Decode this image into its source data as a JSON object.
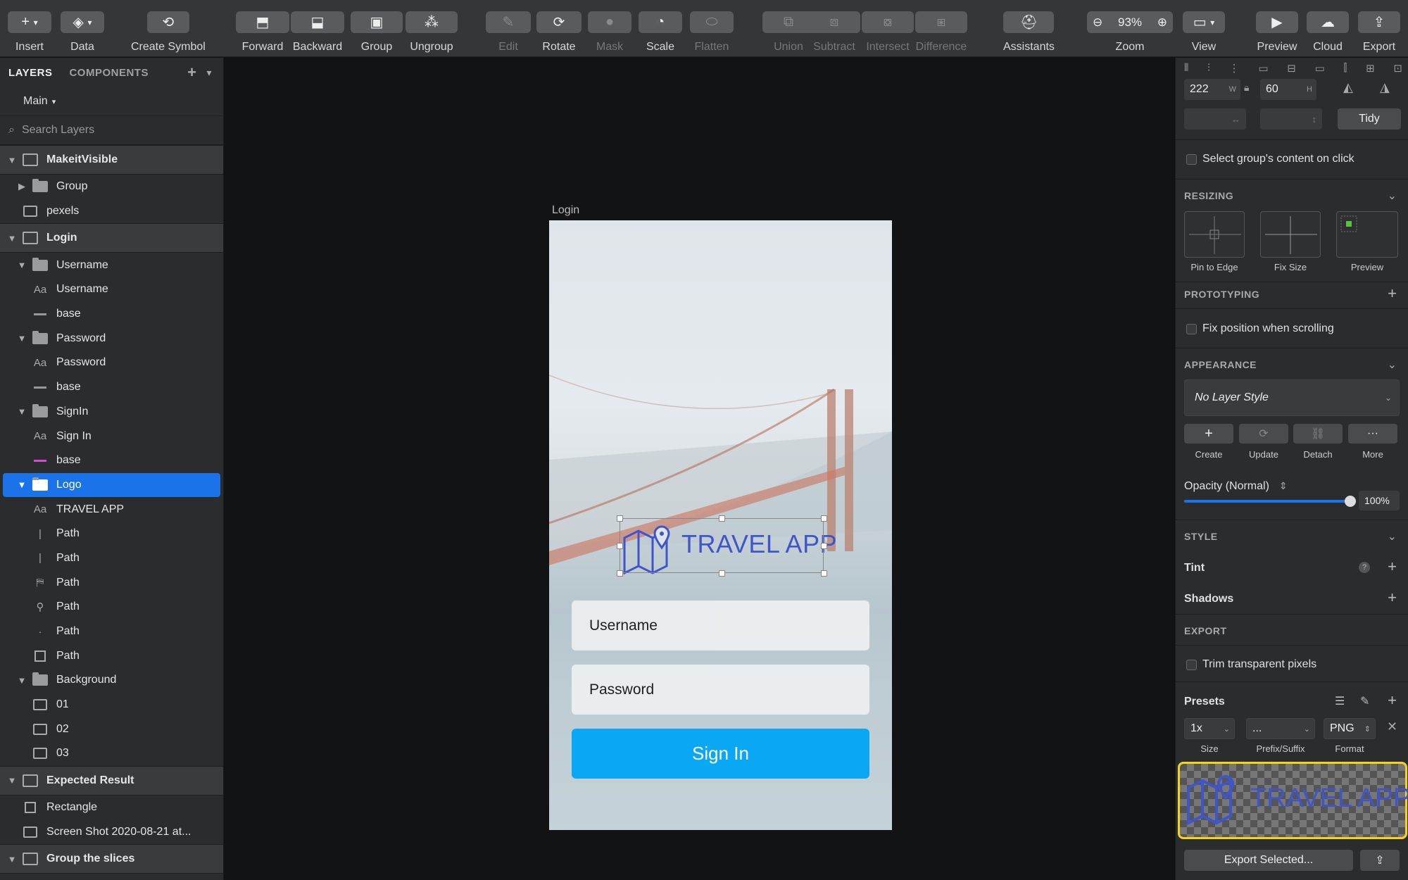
{
  "toolbar": {
    "insert": "Insert",
    "data": "Data",
    "create_symbol": "Create Symbol",
    "forward": "Forward",
    "backward": "Backward",
    "group": "Group",
    "ungroup": "Ungroup",
    "edit": "Edit",
    "rotate": "Rotate",
    "mask": "Mask",
    "scale": "Scale",
    "flatten": "Flatten",
    "union": "Union",
    "subtract": "Subtract",
    "intersect": "Intersect",
    "difference": "Difference",
    "assistants": "Assistants",
    "zoom_label": "Zoom",
    "zoom_value": "93%",
    "view": "View",
    "preview": "Preview",
    "cloud": "Cloud",
    "export": "Export"
  },
  "sidebar": {
    "tab_layers": "LAYERS",
    "tab_components": "COMPONENTS",
    "page": "Main",
    "search_placeholder": "Search Layers",
    "layers": [
      {
        "label": "MakeitVisible",
        "kind": "artboard"
      },
      {
        "label": "Group",
        "kind": "folder"
      },
      {
        "label": "pexels",
        "kind": "image"
      },
      {
        "label": "Login",
        "kind": "artboard"
      },
      {
        "label": "Username",
        "kind": "folder"
      },
      {
        "label": "Username",
        "kind": "text"
      },
      {
        "label": "base",
        "kind": "shape"
      },
      {
        "label": "Password",
        "kind": "folder"
      },
      {
        "label": "Password",
        "kind": "text"
      },
      {
        "label": "base",
        "kind": "shape"
      },
      {
        "label": "SignIn",
        "kind": "folder"
      },
      {
        "label": "Sign In",
        "kind": "text"
      },
      {
        "label": "base",
        "kind": "shape"
      },
      {
        "label": "Logo",
        "kind": "folder"
      },
      {
        "label": "TRAVEL APP",
        "kind": "text"
      },
      {
        "label": "Path",
        "kind": "path"
      },
      {
        "label": "Path",
        "kind": "path"
      },
      {
        "label": "Path",
        "kind": "path"
      },
      {
        "label": "Path",
        "kind": "path"
      },
      {
        "label": "Path",
        "kind": "path"
      },
      {
        "label": "Path",
        "kind": "path"
      },
      {
        "label": "Background",
        "kind": "folder"
      },
      {
        "label": "01",
        "kind": "image"
      },
      {
        "label": "02",
        "kind": "image"
      },
      {
        "label": "03",
        "kind": "image"
      },
      {
        "label": "Expected Result",
        "kind": "artboard"
      },
      {
        "label": "Rectangle",
        "kind": "shape"
      },
      {
        "label": "Screen Shot 2020-08-21 at...",
        "kind": "image"
      },
      {
        "label": "Group the slices",
        "kind": "artboard"
      }
    ]
  },
  "canvas": {
    "artboard_label": "Login",
    "logo_text": "TRAVEL APP",
    "username_placeholder": "Username",
    "password_placeholder": "Password",
    "signin_label": "Sign In"
  },
  "inspector": {
    "width": "222",
    "width_label": "W",
    "height": "60",
    "height_label": "H",
    "tidy": "Tidy",
    "select_group_content": "Select group's content on click",
    "resizing": "RESIZING",
    "pin_to_edge": "Pin to Edge",
    "fix_size": "Fix Size",
    "resize_preview": "Preview",
    "prototyping": "PROTOTYPING",
    "fix_position": "Fix position when scrolling",
    "appearance": "APPEARANCE",
    "layer_style": "No Layer Style",
    "create": "Create",
    "update": "Update",
    "detach": "Detach",
    "more": "More",
    "opacity_label": "Opacity (Normal)",
    "opacity_value": "100%",
    "opacity_fraction": 1.0,
    "style": "STYLE",
    "tint": "Tint",
    "shadows": "Shadows",
    "export": "EXPORT",
    "trim": "Trim transparent pixels",
    "presets": "Presets",
    "size_value": "1x",
    "size_label": "Size",
    "prefix_value": "...",
    "prefix_label": "Prefix/Suffix",
    "format_value": "PNG",
    "format_label": "Format",
    "preview_text": "TRAVEL APP",
    "export_selected": "Export Selected..."
  },
  "colors": {
    "selection": "#1a73e8",
    "signin_button": "#0aa7f5",
    "logo_blue": "#3f55c9",
    "preview_highlight": "#f5d31a"
  }
}
